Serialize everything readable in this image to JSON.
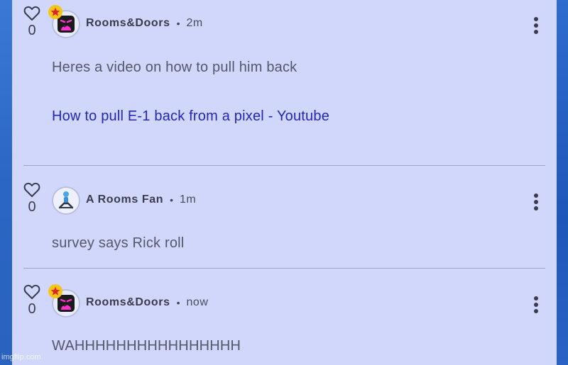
{
  "comments": [
    {
      "username": "Rooms&Doors",
      "dot": "•",
      "time": "2m",
      "likes": "0",
      "text": "Heres a video on how to pull him back",
      "link": "How to pull E-1 back from a pixel - Youtube",
      "avatar": "screaming-face-avatar",
      "badge": "star-badge"
    },
    {
      "username": "A Rooms Fan",
      "dot": "•",
      "time": "1m",
      "likes": "0",
      "text": "survey says Rick roll",
      "avatar": "figure-avatar"
    },
    {
      "username": "Rooms&Doors",
      "dot": "•",
      "time": "now",
      "likes": "0",
      "text": "WAHHHHHHHHHHHHHHHH",
      "avatar": "screaming-face-avatar",
      "badge": "star-badge"
    }
  ],
  "watermark": "imgflip.com",
  "colors": {
    "panel": "#d0d7fa",
    "link": "#2226b5",
    "star": "#f5c518",
    "background": "#2f6fd0"
  }
}
